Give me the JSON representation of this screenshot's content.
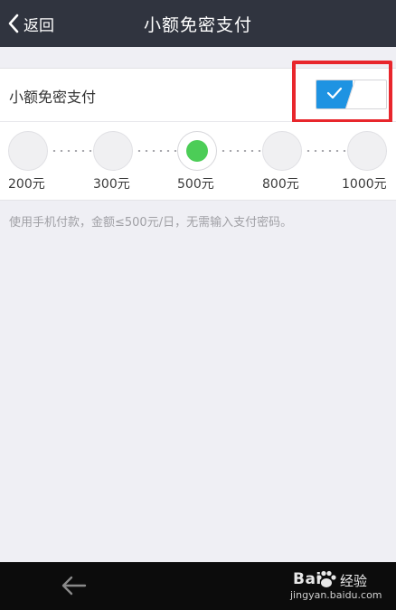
{
  "header": {
    "back_label": "返回",
    "title": "小额免密支付"
  },
  "toggle_row": {
    "label": "小额免密支付",
    "enabled": true,
    "highlight_color": "#e8262c",
    "on_color": "#1e93e2"
  },
  "amounts": {
    "options": [
      "200元",
      "300元",
      "500元",
      "800元",
      "1000元"
    ],
    "selected": "500元",
    "selected_color": "#4ccd57"
  },
  "note": "使用手机付款，金额≤500元/日，无需输入支付密码。",
  "navbar": {
    "back_icon": "arrow-left-icon"
  },
  "watermark": {
    "brand": "Bai",
    "brand_icon": "paw-icon",
    "suffix": "经验",
    "url": "jingyan.baidu.com"
  }
}
